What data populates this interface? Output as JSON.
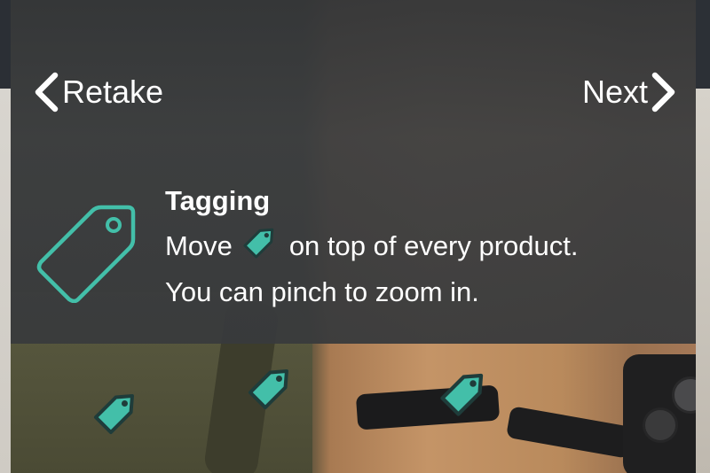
{
  "header": {
    "back_label": "Retake",
    "next_label": "Next"
  },
  "instructions": {
    "title": "Tagging",
    "line1_before": "Move",
    "line1_after": "on top of every product.",
    "line2": "You can pinch to zoom in."
  },
  "colors": {
    "accent": "#43bfa9",
    "tag_outline": "#1f3c3a",
    "overlay": "#3a3c3e",
    "text": "#ffffff"
  },
  "icons": {
    "back": "chevron-left-icon",
    "next": "chevron-right-icon",
    "tag": "tag-icon"
  }
}
